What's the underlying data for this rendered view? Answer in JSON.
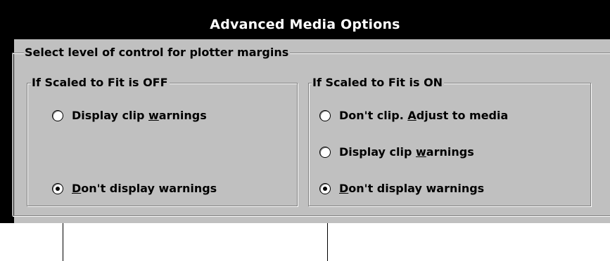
{
  "dialog": {
    "title": "Advanced Media Options"
  },
  "group": {
    "label": "Select level of control for plotter margins"
  },
  "scaled_off": {
    "label": "If Scaled to Fit is OFF",
    "options": [
      {
        "pre": "Display clip ",
        "key": "w",
        "post": "arnings",
        "checked": false
      },
      {
        "pre": "",
        "key": "D",
        "post": "on't display warnings",
        "checked": true
      }
    ]
  },
  "scaled_on": {
    "label": "If Scaled to Fit is ON",
    "options": [
      {
        "pre": "Don't clip. ",
        "key": "A",
        "post": "djust to media",
        "checked": false
      },
      {
        "pre": "Display clip ",
        "key": "w",
        "post": "arnings",
        "checked": false
      },
      {
        "pre": "",
        "key": "D",
        "post": "on't display warnings",
        "checked": true
      }
    ]
  }
}
